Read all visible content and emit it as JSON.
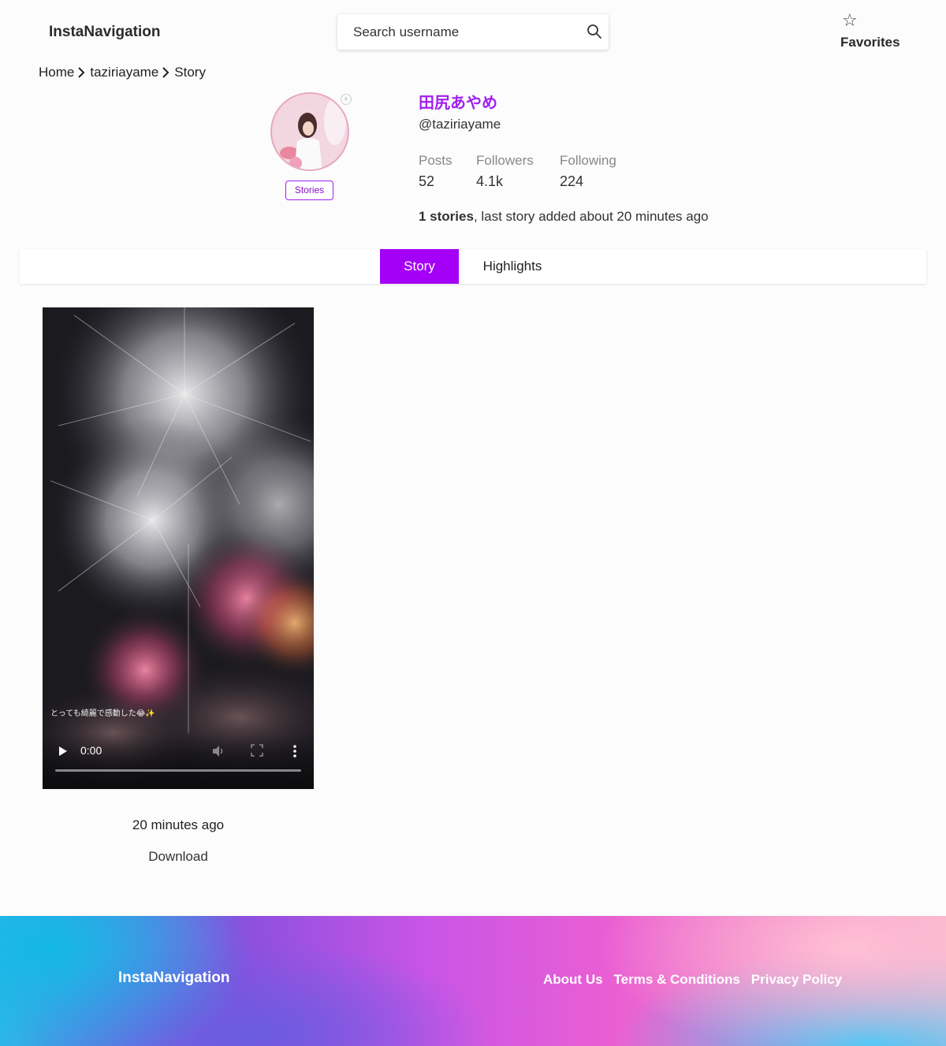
{
  "header": {
    "logo": "InstaNavigation",
    "search_placeholder": "Search username",
    "favorites_label": "Favorites"
  },
  "breadcrumb": {
    "home": "Home",
    "user": "taziriayame",
    "current": "Story"
  },
  "profile": {
    "name": "田尻あやめ",
    "handle": "@taziriayame",
    "stories_badge": "Stories",
    "stats": [
      {
        "label": "Posts",
        "value": "52"
      },
      {
        "label": "Followers",
        "value": "4.1k"
      },
      {
        "label": "Following",
        "value": "224"
      }
    ],
    "stories_count": "1 stories",
    "stories_suffix": ", last story added about 20 minutes ago"
  },
  "tabs": {
    "story": "Story",
    "highlights": "Highlights",
    "active": "Story"
  },
  "story": {
    "caption": "とっても綺麗で感動した😂✨",
    "time_display": "0:00",
    "posted": "20 minutes ago",
    "download_label": "Download"
  },
  "footer": {
    "logo": "InstaNavigation",
    "links": [
      "About Us",
      "Terms & Conditions",
      "Privacy Policy"
    ]
  },
  "colors": {
    "accent": "#a400f7",
    "name": "#a020f0"
  }
}
